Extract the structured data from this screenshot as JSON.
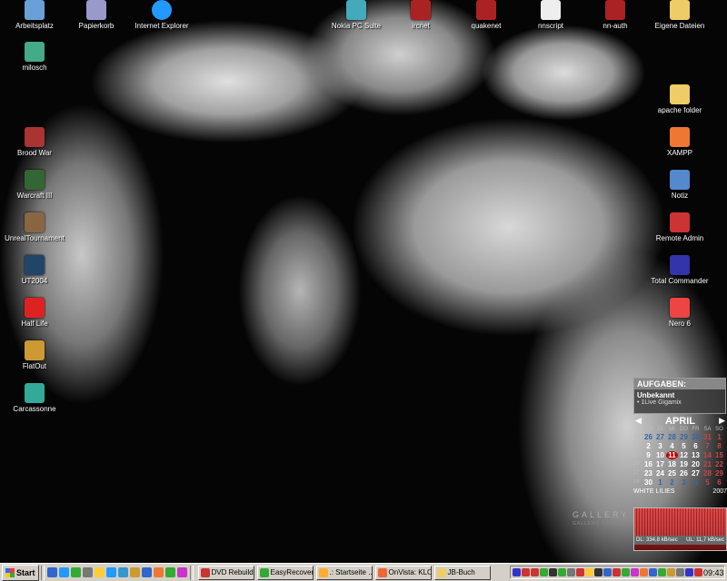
{
  "desktop_icons": {
    "arbeitsplatz": {
      "label": "Arbeitsplatz",
      "icon": "computer-icon",
      "color": "#6aa0d8"
    },
    "milosch": {
      "label": "milosch",
      "icon": "network-user-icon",
      "color": "#4a8"
    },
    "brood_war": {
      "label": "Brood War",
      "icon": "starcraft-icon",
      "color": "#a33"
    },
    "warcraft": {
      "label": "Warcraft III",
      "icon": "warcraft-icon",
      "color": "#363"
    },
    "unreal": {
      "label": "UnrealTournament",
      "icon": "unreal-icon",
      "color": "#864"
    },
    "ut2004": {
      "label": "UT2004",
      "icon": "ut2004-icon",
      "color": "#246"
    },
    "halflife": {
      "label": "Half Life",
      "icon": "halflife-icon",
      "color": "#d22"
    },
    "flatout": {
      "label": "FlatOut",
      "icon": "flatout-icon",
      "color": "#c93"
    },
    "carcassonne": {
      "label": "Carcassonne",
      "icon": "carcassonne-icon",
      "color": "#3a9"
    },
    "papierkorb": {
      "label": "Papierkorb",
      "icon": "recycle-bin-icon",
      "color": "#99c"
    },
    "ie": {
      "label": "Internet Explorer",
      "icon": "internet-explorer-icon",
      "color": "#29f"
    },
    "nokia": {
      "label": "Nokia PC Suite",
      "icon": "nokia-icon",
      "color": "#4ab"
    },
    "ircnet": {
      "label": "ircnet",
      "icon": "mirc-icon",
      "color": "#a22"
    },
    "quakenet": {
      "label": "quakenet",
      "icon": "mirc-icon",
      "color": "#a22"
    },
    "nnscript": {
      "label": "nnscript",
      "icon": "script-icon",
      "color": "#eee"
    },
    "nnauth": {
      "label": "nn-auth",
      "icon": "mirc-icon",
      "color": "#a22"
    },
    "eigene": {
      "label": "Eigene Dateien",
      "icon": "documents-folder-icon",
      "color": "#ec6"
    },
    "apache": {
      "label": "apache folder",
      "icon": "folder-icon",
      "color": "#ec6"
    },
    "xampp": {
      "label": "XAMPP",
      "icon": "xampp-icon",
      "color": "#e73"
    },
    "notiz": {
      "label": "Notiz",
      "icon": "notepad-icon",
      "color": "#58c"
    },
    "remote": {
      "label": "Remote Admin",
      "icon": "remote-admin-icon",
      "color": "#c33"
    },
    "total": {
      "label": "Total Commander",
      "icon": "floppy-disk-icon",
      "color": "#33a"
    },
    "nero": {
      "label": "Nero 6",
      "icon": "nero-icon",
      "color": "#e44"
    }
  },
  "tasks_widget": {
    "header": "AUFGABEN:",
    "title": "Unbekannt",
    "item": "• 1Live Gigamix"
  },
  "calendar": {
    "month": "APRIL",
    "day_headers": [
      "MO",
      "DI",
      "MI",
      "DO",
      "FR",
      "SA",
      "SO"
    ],
    "weeks": [
      {
        "wk": "13",
        "days": [
          "26",
          "27",
          "28",
          "29",
          "30",
          "31",
          "1"
        ]
      },
      {
        "wk": "14",
        "days": [
          "2",
          "3",
          "4",
          "5",
          "6",
          "7",
          "8"
        ]
      },
      {
        "wk": "15",
        "days": [
          "9",
          "10",
          "11",
          "12",
          "13",
          "14",
          "15"
        ]
      },
      {
        "wk": "16",
        "days": [
          "16",
          "17",
          "18",
          "19",
          "20",
          "21",
          "22"
        ]
      },
      {
        "wk": "17",
        "days": [
          "23",
          "24",
          "25",
          "26",
          "27",
          "28",
          "29"
        ]
      },
      {
        "wk": "18",
        "days": [
          "30",
          "1",
          "2",
          "3",
          "4",
          "5",
          "6"
        ]
      }
    ],
    "today": "11",
    "footer_left": "WHITE LILIES",
    "footer_right": "2007"
  },
  "gallery": {
    "text": "GALLERY",
    "sub": "GALLERY ARTOFBEING"
  },
  "netmeter": {
    "dl": "DL: 334,8 kB/sec",
    "ul": "UL: 11,7 kB/sec"
  },
  "taskbar": {
    "start": "Start",
    "quicklaunch_colors": [
      "#36c",
      "#29f",
      "#3a3",
      "#777",
      "#fc3",
      "#29f",
      "#39c",
      "#c93",
      "#36c",
      "#e73",
      "#3a3",
      "#c3c"
    ],
    "tasks": [
      {
        "label": "DVD Rebuilde...",
        "icon": "dvd-icon",
        "color": "#c33"
      },
      {
        "label": "EasyRecover...",
        "icon": "recovery-icon",
        "color": "#3a3"
      },
      {
        "label": ".: Startseite ...",
        "icon": "browser-icon",
        "color": "#fa3"
      },
      {
        "label": "OnVista: KLO...",
        "icon": "firefox-icon",
        "color": "#e63"
      },
      {
        "label": "JB-Buch",
        "icon": "folder-icon",
        "color": "#ec6"
      }
    ],
    "tray_colors": [
      "#33c",
      "#c33",
      "#c33",
      "#3a3",
      "#333",
      "#3a3",
      "#777",
      "#c33",
      "#fc3",
      "#333",
      "#36c",
      "#c33",
      "#3a3",
      "#c3c",
      "#e73",
      "#36c",
      "#3a3",
      "#c93",
      "#777",
      "#33c",
      "#c33"
    ],
    "clock": "09:43"
  }
}
